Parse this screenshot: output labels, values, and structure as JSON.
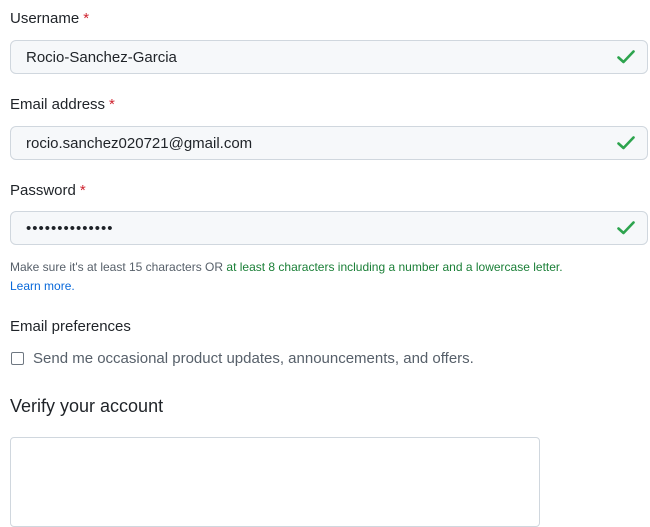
{
  "username": {
    "label": "Username",
    "required_mark": "*",
    "value": "Rocio-Sanchez-Garcia",
    "valid": true
  },
  "email": {
    "label": "Email address",
    "required_mark": "*",
    "value": "rocio.sanchez020721@gmail.com",
    "valid": true
  },
  "password": {
    "label": "Password",
    "required_mark": "*",
    "masked_value": "••••••••••••••",
    "valid": true
  },
  "password_hint": {
    "part1": "Make sure it's at least 15 characters OR",
    "part2": "at least 8 characters including a number and a lowercase letter.",
    "learn_more": "Learn more."
  },
  "email_preferences": {
    "title": "Email preferences",
    "checkbox_label": "Send me occasional product updates, announcements, and offers.",
    "checked": false
  },
  "verify": {
    "title": "Verify your account"
  },
  "colors": {
    "check_green": "#2da44e",
    "required_red": "#cf222e",
    "link_blue": "#0969da"
  }
}
